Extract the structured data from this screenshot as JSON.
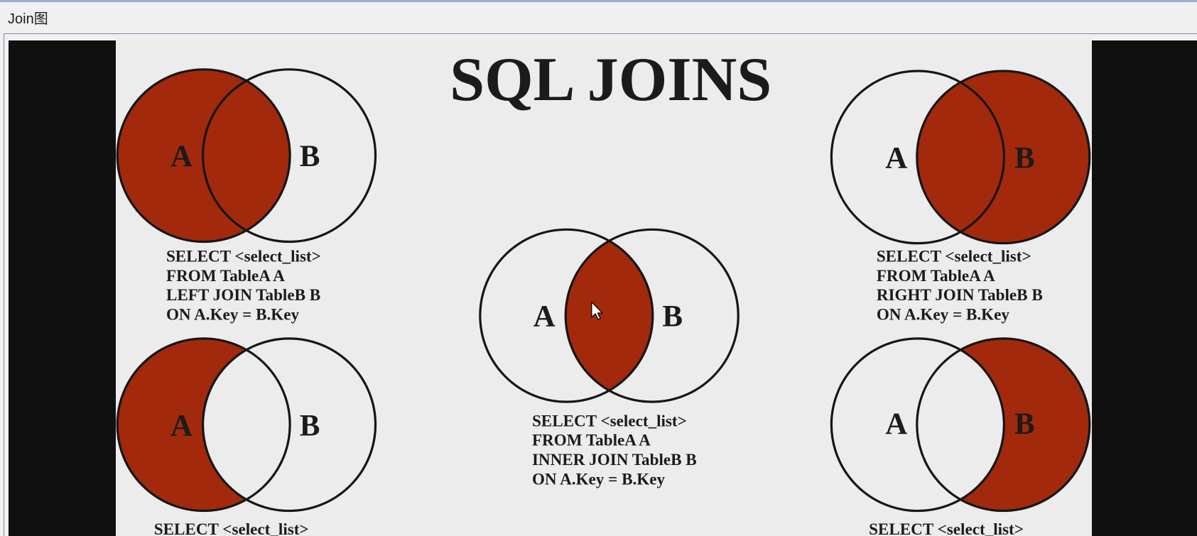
{
  "window": {
    "title": "Join图"
  },
  "diagram": {
    "title": "SQL JOINS",
    "fill_color": "#a3290d",
    "background": "#ececec",
    "left_join": {
      "label_a": "A",
      "label_b": "B",
      "sql": [
        "SELECT <select_list>",
        "FROM TableA A",
        "LEFT JOIN TableB B",
        "ON A.Key = B.Key"
      ]
    },
    "inner_join": {
      "label_a": "A",
      "label_b": "B",
      "sql": [
        "SELECT <select_list>",
        "FROM TableA A",
        "INNER JOIN TableB B",
        "ON A.Key = B.Key"
      ]
    },
    "right_join": {
      "label_a": "A",
      "label_b": "B",
      "sql": [
        "SELECT <select_list>",
        "FROM TableA A",
        "RIGHT JOIN TableB B",
        "ON A.Key = B.Key"
      ]
    },
    "left_excluding": {
      "label_a": "A",
      "label_b": "B",
      "sql": [
        "SELECT <select_list>"
      ]
    },
    "right_excluding": {
      "label_a": "A",
      "label_b": "B",
      "sql": [
        "SELECT <select_list>"
      ]
    }
  }
}
